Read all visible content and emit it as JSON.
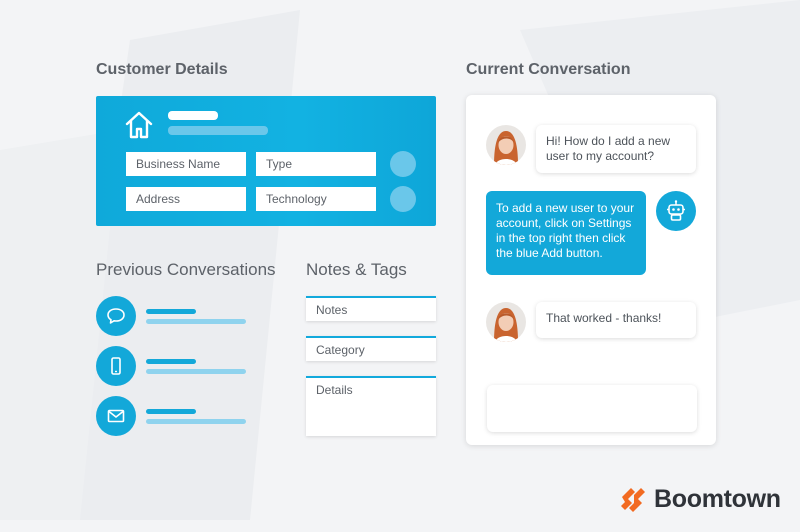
{
  "customer_details": {
    "title": "Customer Details",
    "fields": {
      "business_name": "Business Name",
      "type": "Type",
      "address": "Address",
      "technology": "Technology"
    }
  },
  "previous_conversations": {
    "title": "Previous Conversations",
    "items": [
      {
        "icon": "chat-bubble-icon"
      },
      {
        "icon": "mobile-phone-icon"
      },
      {
        "icon": "envelope-icon"
      }
    ]
  },
  "notes_tags": {
    "title": "Notes & Tags",
    "fields": {
      "notes": "Notes",
      "category": "Category",
      "details": "Details"
    }
  },
  "current_conversation": {
    "title": "Current Conversation",
    "messages": [
      {
        "sender": "user",
        "line1": "Hi! How do I add a new",
        "line2": "user to my account?"
      },
      {
        "sender": "bot",
        "line1": "To add a new user to your",
        "line2": "account, click on Settings",
        "line3": "in the top right then click",
        "line4": "the blue Add button."
      },
      {
        "sender": "user",
        "line1": "That worked - thanks!"
      }
    ]
  },
  "brand": {
    "name": "Boomtown",
    "colors": {
      "accent": "#13a8d9",
      "logo_orange": "#f26a21",
      "text_dark": "#2f3339"
    }
  }
}
